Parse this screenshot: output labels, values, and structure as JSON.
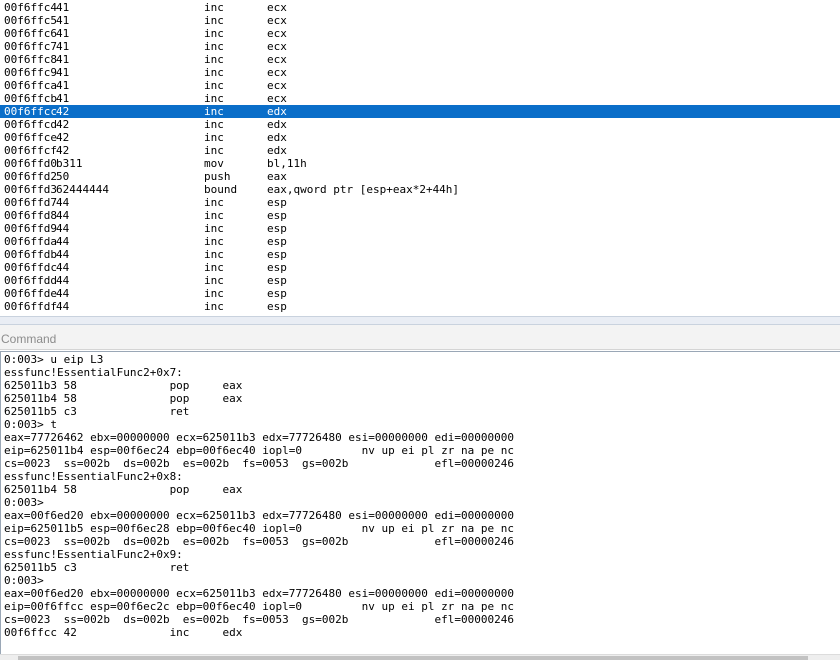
{
  "disassembly": {
    "selected_index": 8,
    "rows": [
      {
        "addr": "00f6ffc4",
        "bytes": "41",
        "mnem": "inc",
        "ops": "ecx"
      },
      {
        "addr": "00f6ffc5",
        "bytes": "41",
        "mnem": "inc",
        "ops": "ecx"
      },
      {
        "addr": "00f6ffc6",
        "bytes": "41",
        "mnem": "inc",
        "ops": "ecx"
      },
      {
        "addr": "00f6ffc7",
        "bytes": "41",
        "mnem": "inc",
        "ops": "ecx"
      },
      {
        "addr": "00f6ffc8",
        "bytes": "41",
        "mnem": "inc",
        "ops": "ecx"
      },
      {
        "addr": "00f6ffc9",
        "bytes": "41",
        "mnem": "inc",
        "ops": "ecx"
      },
      {
        "addr": "00f6ffca",
        "bytes": "41",
        "mnem": "inc",
        "ops": "ecx"
      },
      {
        "addr": "00f6ffcb",
        "bytes": "41",
        "mnem": "inc",
        "ops": "ecx"
      },
      {
        "addr": "00f6ffcc",
        "bytes": "42",
        "mnem": "inc",
        "ops": "edx"
      },
      {
        "addr": "00f6ffcd",
        "bytes": "42",
        "mnem": "inc",
        "ops": "edx"
      },
      {
        "addr": "00f6ffce",
        "bytes": "42",
        "mnem": "inc",
        "ops": "edx"
      },
      {
        "addr": "00f6ffcf",
        "bytes": "42",
        "mnem": "inc",
        "ops": "edx"
      },
      {
        "addr": "00f6ffd0",
        "bytes": "b311",
        "mnem": "mov",
        "ops": "bl,11h"
      },
      {
        "addr": "00f6ffd2",
        "bytes": "50",
        "mnem": "push",
        "ops": "eax"
      },
      {
        "addr": "00f6ffd3",
        "bytes": "62444444",
        "mnem": "bound",
        "ops": "eax,qword ptr [esp+eax*2+44h]"
      },
      {
        "addr": "00f6ffd7",
        "bytes": "44",
        "mnem": "inc",
        "ops": "esp"
      },
      {
        "addr": "00f6ffd8",
        "bytes": "44",
        "mnem": "inc",
        "ops": "esp"
      },
      {
        "addr": "00f6ffd9",
        "bytes": "44",
        "mnem": "inc",
        "ops": "esp"
      },
      {
        "addr": "00f6ffda",
        "bytes": "44",
        "mnem": "inc",
        "ops": "esp"
      },
      {
        "addr": "00f6ffdb",
        "bytes": "44",
        "mnem": "inc",
        "ops": "esp"
      },
      {
        "addr": "00f6ffdc",
        "bytes": "44",
        "mnem": "inc",
        "ops": "esp"
      },
      {
        "addr": "00f6ffdd",
        "bytes": "44",
        "mnem": "inc",
        "ops": "esp"
      },
      {
        "addr": "00f6ffde",
        "bytes": "44",
        "mnem": "inc",
        "ops": "esp"
      },
      {
        "addr": "00f6ffdf",
        "bytes": "44",
        "mnem": "inc",
        "ops": "esp"
      }
    ]
  },
  "command": {
    "title": "Command",
    "lines": [
      "0:003> u eip L3",
      "essfunc!EssentialFunc2+0x7:",
      "625011b3 58              pop     eax",
      "625011b4 58              pop     eax",
      "625011b5 c3              ret",
      "0:003> t",
      "eax=77726462 ebx=00000000 ecx=625011b3 edx=77726480 esi=00000000 edi=00000000",
      "eip=625011b4 esp=00f6ec24 ebp=00f6ec40 iopl=0         nv up ei pl zr na pe nc",
      "cs=0023  ss=002b  ds=002b  es=002b  fs=0053  gs=002b             efl=00000246",
      "essfunc!EssentialFunc2+0x8:",
      "625011b4 58              pop     eax",
      "0:003>",
      "eax=00f6ed20 ebx=00000000 ecx=625011b3 edx=77726480 esi=00000000 edi=00000000",
      "eip=625011b5 esp=00f6ec28 ebp=00f6ec40 iopl=0         nv up ei pl zr na pe nc",
      "cs=0023  ss=002b  ds=002b  es=002b  fs=0053  gs=002b             efl=00000246",
      "essfunc!EssentialFunc2+0x9:",
      "625011b5 c3              ret",
      "0:003>",
      "eax=00f6ed20 ebx=00000000 ecx=625011b3 edx=77726480 esi=00000000 edi=00000000",
      "eip=00f6ffcc esp=00f6ec2c ebp=00f6ec40 iopl=0         nv up ei pl zr na pe nc",
      "cs=0023  ss=002b  ds=002b  es=002b  fs=0053  gs=002b             efl=00000246",
      "00f6ffcc 42              inc     edx"
    ]
  },
  "colors": {
    "selection": "#0a6ec9"
  }
}
